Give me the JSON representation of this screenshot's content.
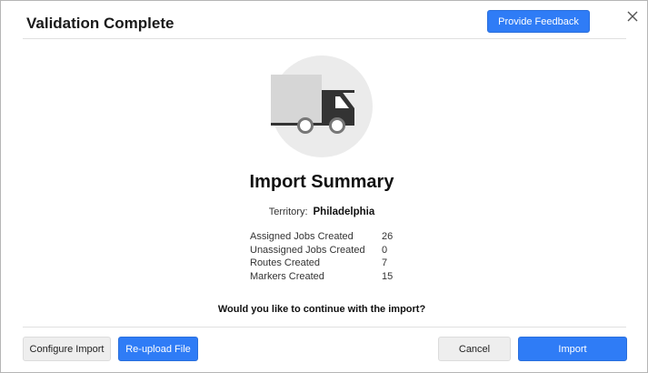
{
  "dialog": {
    "title": "Validation Complete",
    "feedback_label": "Provide Feedback"
  },
  "illustration": {
    "icon": "truck-icon",
    "circle_color": "#ebebeb",
    "cargo_color": "#d6d6d6",
    "cab_color": "#333333"
  },
  "summary": {
    "title": "Import Summary",
    "territory_label": "Territory:",
    "territory_value": "Philadelphia",
    "stats": [
      {
        "label": "Assigned Jobs Created",
        "value": "26"
      },
      {
        "label": "Unassigned Jobs Created",
        "value": "0"
      },
      {
        "label": "Routes Created",
        "value": "7"
      },
      {
        "label": "Markers Created",
        "value": "15"
      }
    ],
    "question": "Would you like to continue with the import?"
  },
  "footer": {
    "configure_label": "Configure Import",
    "reupload_label": "Re-upload File",
    "cancel_label": "Cancel",
    "import_label": "Import"
  },
  "colors": {
    "primary": "#2f7cf6",
    "secondary": "#eeeeee"
  }
}
